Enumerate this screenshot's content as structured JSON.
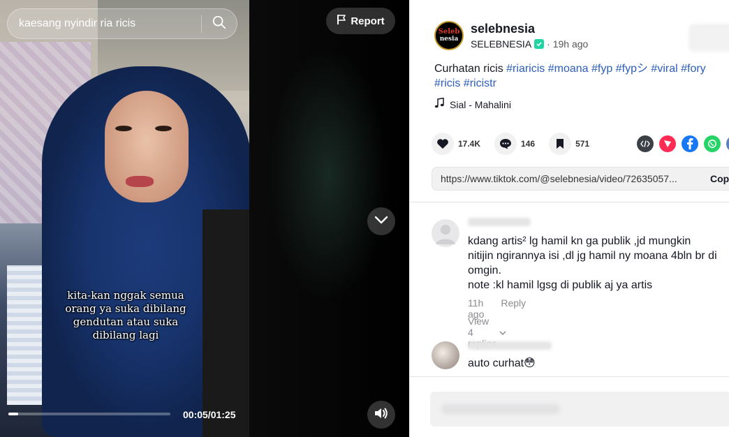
{
  "player": {
    "search": {
      "value": "kaesang nyindir ria ricis"
    },
    "report_label": "Report",
    "caption_lines": [
      "kita-kan nggak semua",
      "orang ya suka dibilang",
      "gendutan atau suka",
      "dibilang lagi"
    ],
    "time_display": "00:05/01:25",
    "progress_fraction": 0.06
  },
  "post": {
    "avatar_lines": [
      "Seleb",
      "nesia"
    ],
    "author_name": "selebnesia",
    "author_handle": "SELEBNESIA",
    "time_ago": "· 19h ago",
    "description_text": "Curhatan ricis",
    "hashtags": [
      "#riaricis",
      "#moana",
      "#fyp",
      "#fypシ",
      "#viral",
      "#fory"
    ],
    "hashtags_line2": [
      "#ricis",
      "#ricistr"
    ],
    "music": "Sial - Mahalini",
    "likes": "17.4K",
    "comments": "146",
    "saves": "571",
    "link": "https://www.tiktok.com/@selebnesia/video/72635057...",
    "copy_label": "Copy",
    "share_colors": {
      "embed": "#3b3f46",
      "send": "#fe2c55",
      "facebook": "#1877f2",
      "whatsapp": "#25d366"
    }
  },
  "comments": [
    {
      "lines": [
        "kdang artis² lg hamil kn ga publik ,jd mungkin",
        "nitijin ngirannya isi ,dl jg hamil ny moana 4bln br di",
        "omgin.",
        "note :kl hamil lgsg di publik aj ya artis"
      ],
      "time": "11h ago",
      "reply_label": "Reply",
      "view_replies": "View 4 replies"
    },
    {
      "lines": [
        "auto curhat😳"
      ]
    }
  ]
}
